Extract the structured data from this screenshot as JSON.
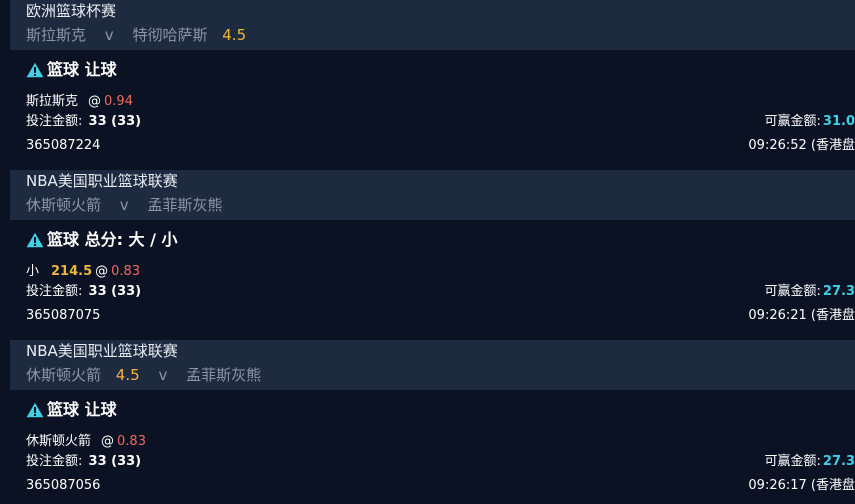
{
  "bets": [
    {
      "league": "欧洲篮球杯赛",
      "home": "斯拉斯克",
      "handicap_home": "",
      "vs": "v",
      "away": "特彻哈萨斯",
      "handicap_away": "4.5",
      "market": "篮球 让球",
      "selection": "斯拉斯克",
      "selection_line": "",
      "at": "@",
      "odds": "0.94",
      "stake_label": "投注金额:",
      "stake_value": "33 (33)",
      "win_label": "可赢金额:",
      "win_value": "31.0",
      "ref": "365087224",
      "time": "09:26:52 (香港盘"
    },
    {
      "league": "NBA美国职业篮球联赛",
      "home": "休斯顿火箭",
      "handicap_home": "",
      "vs": "v",
      "away": "孟菲斯灰熊",
      "handicap_away": "",
      "market": "篮球 总分: 大 / 小",
      "selection": "小",
      "selection_line": "214.5",
      "at": "@",
      "odds": "0.83",
      "stake_label": "投注金额:",
      "stake_value": "33 (33)",
      "win_label": "可赢金额:",
      "win_value": "27.3",
      "ref": "365087075",
      "time": "09:26:21 (香港盘"
    },
    {
      "league": "NBA美国职业篮球联赛",
      "home": "休斯顿火箭",
      "handicap_home": "4.5",
      "vs": "v",
      "away": "孟菲斯灰熊",
      "handicap_away": "",
      "market": "篮球 让球",
      "selection": "休斯顿火箭",
      "selection_line": "",
      "at": "@",
      "odds": "0.83",
      "stake_label": "投注金额:",
      "stake_value": "33 (33)",
      "win_label": "可赢金额:",
      "win_value": "27.3",
      "ref": "365087056",
      "time": "09:26:17 (香港盘"
    }
  ],
  "colors": {
    "background": "#0a1224",
    "header_bg": "#1e2a40",
    "odds": "#ef6a5c",
    "handicap": "#f0b43c",
    "win": "#3fd0e6",
    "warning": "#3fd0e6"
  },
  "icons": {
    "market_icon": "warning-triangle-icon"
  }
}
